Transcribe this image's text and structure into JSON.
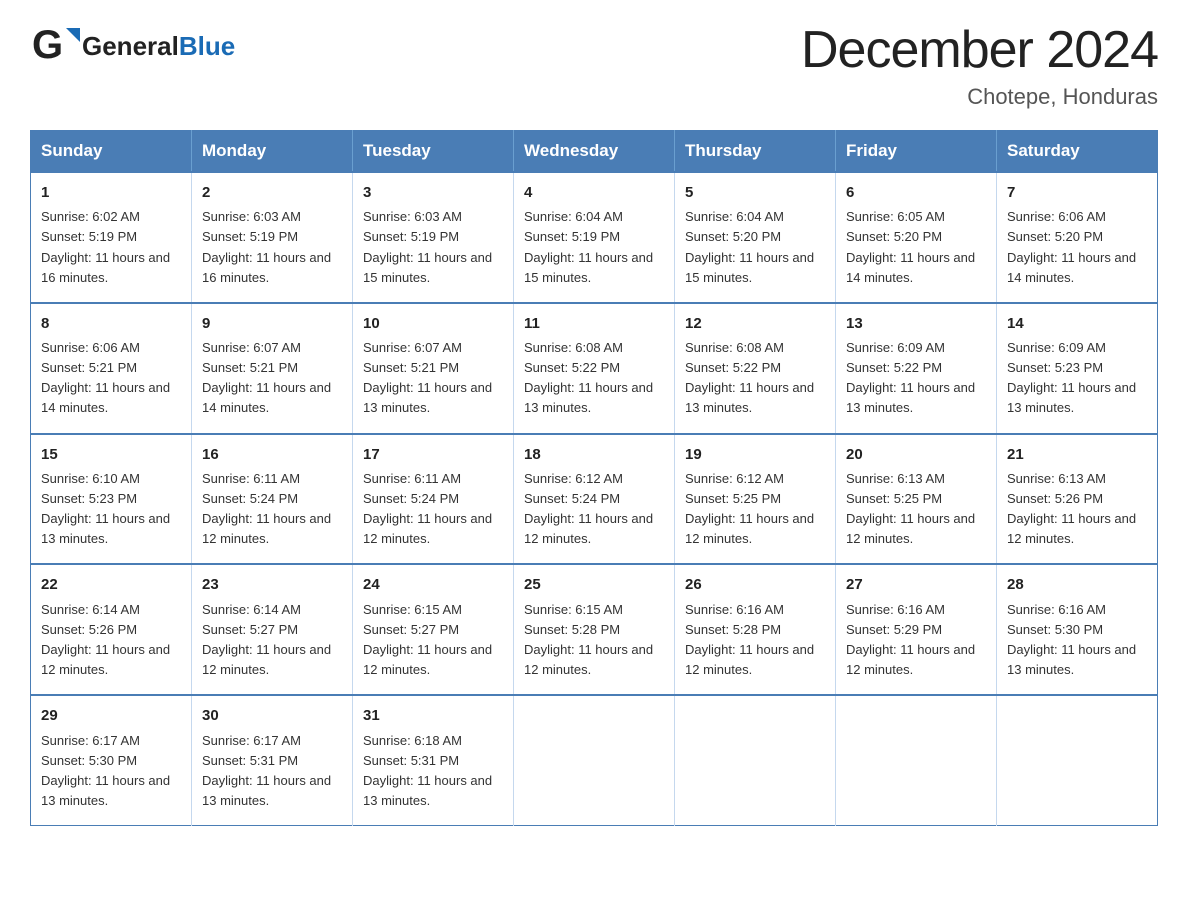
{
  "header": {
    "logo_general": "General",
    "logo_blue": "Blue",
    "title": "December 2024",
    "subtitle": "Chotepe, Honduras"
  },
  "weekdays": [
    "Sunday",
    "Monday",
    "Tuesday",
    "Wednesday",
    "Thursday",
    "Friday",
    "Saturday"
  ],
  "weeks": [
    [
      {
        "day": "1",
        "sunrise": "6:02 AM",
        "sunset": "5:19 PM",
        "daylight": "11 hours and 16 minutes."
      },
      {
        "day": "2",
        "sunrise": "6:03 AM",
        "sunset": "5:19 PM",
        "daylight": "11 hours and 16 minutes."
      },
      {
        "day": "3",
        "sunrise": "6:03 AM",
        "sunset": "5:19 PM",
        "daylight": "11 hours and 15 minutes."
      },
      {
        "day": "4",
        "sunrise": "6:04 AM",
        "sunset": "5:19 PM",
        "daylight": "11 hours and 15 minutes."
      },
      {
        "day": "5",
        "sunrise": "6:04 AM",
        "sunset": "5:20 PM",
        "daylight": "11 hours and 15 minutes."
      },
      {
        "day": "6",
        "sunrise": "6:05 AM",
        "sunset": "5:20 PM",
        "daylight": "11 hours and 14 minutes."
      },
      {
        "day": "7",
        "sunrise": "6:06 AM",
        "sunset": "5:20 PM",
        "daylight": "11 hours and 14 minutes."
      }
    ],
    [
      {
        "day": "8",
        "sunrise": "6:06 AM",
        "sunset": "5:21 PM",
        "daylight": "11 hours and 14 minutes."
      },
      {
        "day": "9",
        "sunrise": "6:07 AM",
        "sunset": "5:21 PM",
        "daylight": "11 hours and 14 minutes."
      },
      {
        "day": "10",
        "sunrise": "6:07 AM",
        "sunset": "5:21 PM",
        "daylight": "11 hours and 13 minutes."
      },
      {
        "day": "11",
        "sunrise": "6:08 AM",
        "sunset": "5:22 PM",
        "daylight": "11 hours and 13 minutes."
      },
      {
        "day": "12",
        "sunrise": "6:08 AM",
        "sunset": "5:22 PM",
        "daylight": "11 hours and 13 minutes."
      },
      {
        "day": "13",
        "sunrise": "6:09 AM",
        "sunset": "5:22 PM",
        "daylight": "11 hours and 13 minutes."
      },
      {
        "day": "14",
        "sunrise": "6:09 AM",
        "sunset": "5:23 PM",
        "daylight": "11 hours and 13 minutes."
      }
    ],
    [
      {
        "day": "15",
        "sunrise": "6:10 AM",
        "sunset": "5:23 PM",
        "daylight": "11 hours and 13 minutes."
      },
      {
        "day": "16",
        "sunrise": "6:11 AM",
        "sunset": "5:24 PM",
        "daylight": "11 hours and 12 minutes."
      },
      {
        "day": "17",
        "sunrise": "6:11 AM",
        "sunset": "5:24 PM",
        "daylight": "11 hours and 12 minutes."
      },
      {
        "day": "18",
        "sunrise": "6:12 AM",
        "sunset": "5:24 PM",
        "daylight": "11 hours and 12 minutes."
      },
      {
        "day": "19",
        "sunrise": "6:12 AM",
        "sunset": "5:25 PM",
        "daylight": "11 hours and 12 minutes."
      },
      {
        "day": "20",
        "sunrise": "6:13 AM",
        "sunset": "5:25 PM",
        "daylight": "11 hours and 12 minutes."
      },
      {
        "day": "21",
        "sunrise": "6:13 AM",
        "sunset": "5:26 PM",
        "daylight": "11 hours and 12 minutes."
      }
    ],
    [
      {
        "day": "22",
        "sunrise": "6:14 AM",
        "sunset": "5:26 PM",
        "daylight": "11 hours and 12 minutes."
      },
      {
        "day": "23",
        "sunrise": "6:14 AM",
        "sunset": "5:27 PM",
        "daylight": "11 hours and 12 minutes."
      },
      {
        "day": "24",
        "sunrise": "6:15 AM",
        "sunset": "5:27 PM",
        "daylight": "11 hours and 12 minutes."
      },
      {
        "day": "25",
        "sunrise": "6:15 AM",
        "sunset": "5:28 PM",
        "daylight": "11 hours and 12 minutes."
      },
      {
        "day": "26",
        "sunrise": "6:16 AM",
        "sunset": "5:28 PM",
        "daylight": "11 hours and 12 minutes."
      },
      {
        "day": "27",
        "sunrise": "6:16 AM",
        "sunset": "5:29 PM",
        "daylight": "11 hours and 12 minutes."
      },
      {
        "day": "28",
        "sunrise": "6:16 AM",
        "sunset": "5:30 PM",
        "daylight": "11 hours and 13 minutes."
      }
    ],
    [
      {
        "day": "29",
        "sunrise": "6:17 AM",
        "sunset": "5:30 PM",
        "daylight": "11 hours and 13 minutes."
      },
      {
        "day": "30",
        "sunrise": "6:17 AM",
        "sunset": "5:31 PM",
        "daylight": "11 hours and 13 minutes."
      },
      {
        "day": "31",
        "sunrise": "6:18 AM",
        "sunset": "5:31 PM",
        "daylight": "11 hours and 13 minutes."
      },
      null,
      null,
      null,
      null
    ]
  ]
}
